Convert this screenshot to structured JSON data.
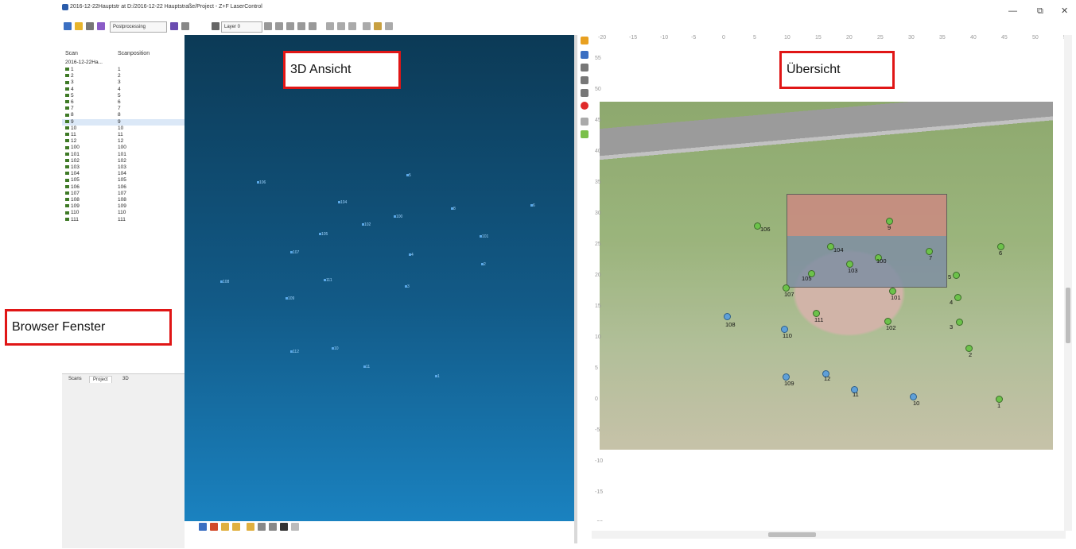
{
  "window": {
    "title": "2016-12-22Hauptstr at D:/2016-12-22 Hauptstraße/Project - Z+F LaserControl",
    "controls": [
      "—",
      "⧉",
      "✕"
    ]
  },
  "toolbar": {
    "postprocessing": "Postprocessing",
    "layer": "Layer 0"
  },
  "browser": {
    "col_scan": "Scan",
    "col_position": "Scanposition",
    "root": "2016-12-22Ha...",
    "rows": [
      [
        "1",
        "1"
      ],
      [
        "2",
        "2"
      ],
      [
        "3",
        "3"
      ],
      [
        "4",
        "4"
      ],
      [
        "5",
        "5"
      ],
      [
        "6",
        "6"
      ],
      [
        "7",
        "7"
      ],
      [
        "8",
        "8"
      ],
      [
        "9",
        "9"
      ],
      [
        "10",
        "10"
      ],
      [
        "11",
        "11"
      ],
      [
        "12",
        "12"
      ],
      [
        "100",
        "100"
      ],
      [
        "101",
        "101"
      ],
      [
        "102",
        "102"
      ],
      [
        "103",
        "103"
      ],
      [
        "104",
        "104"
      ],
      [
        "105",
        "105"
      ],
      [
        "106",
        "106"
      ],
      [
        "107",
        "107"
      ],
      [
        "108",
        "108"
      ],
      [
        "109",
        "109"
      ],
      [
        "110",
        "110"
      ],
      [
        "111",
        "111"
      ]
    ],
    "tabs": [
      "Scans",
      "Project",
      "3D"
    ]
  },
  "callouts": {
    "view3d": "3D Ansicht",
    "overview": "Übersicht",
    "browser": "Browser Fenster"
  },
  "view3d_points": [
    "106",
    "5",
    "104",
    "8",
    "100",
    "102",
    "6",
    "105",
    "101",
    "4",
    "107",
    "108",
    "111",
    "2",
    "3",
    "109",
    "112",
    "10",
    "11",
    "1"
  ],
  "overview": {
    "x_ticks": [
      "-20",
      "-15",
      "-10",
      "-5",
      "0",
      "5",
      "10",
      "15",
      "20",
      "25",
      "30",
      "35",
      "40",
      "45",
      "50",
      "55"
    ],
    "y_ticks": [
      "55",
      "50",
      "45",
      "40",
      "35",
      "30",
      "25",
      "20",
      "15",
      "10",
      "5",
      "0",
      "-5",
      "-10",
      "-15",
      "-20"
    ],
    "points": [
      "106",
      "9",
      "104",
      "7",
      "6",
      "100",
      "103",
      "105",
      "5",
      "107",
      "101",
      "4",
      "111",
      "108",
      "102",
      "3",
      "110",
      "2",
      "12",
      "109",
      "11",
      "10",
      "1"
    ]
  }
}
